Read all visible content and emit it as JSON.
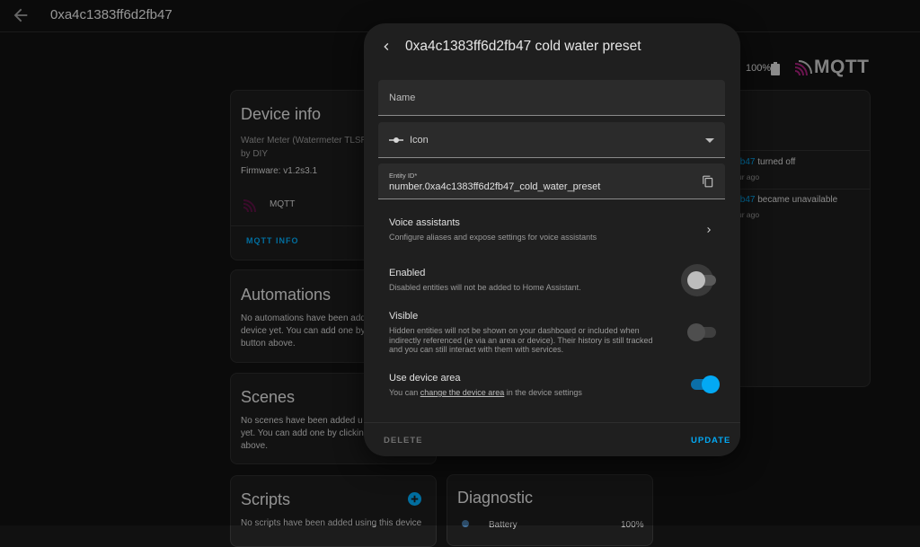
{
  "header": {
    "title": "0xa4c1383ff6d2fb47"
  },
  "topright": {
    "battery_pct": "100%",
    "brand": "MQTT"
  },
  "device_info": {
    "title": "Device info",
    "model": "Water Meter (Watermeter TLSR",
    "by": "by DIY",
    "firmware": "Firmware: v1.2s3.1",
    "integration": "MQTT",
    "link": "MQTT INFO"
  },
  "automations": {
    "title": "Automations",
    "text1": "No automations have been add",
    "text2": "device yet. You can add one by",
    "text3": "button above."
  },
  "scenes": {
    "title": "Scenes",
    "text1": "No scenes have been added u",
    "text2": "yet. You can add one by clickin",
    "text3": "above."
  },
  "scripts": {
    "title": "Scripts",
    "text1": "No scripts have been added using this device"
  },
  "diagnostic": {
    "title": "Diagnostic",
    "row_label": "Battery",
    "row_value": "100%"
  },
  "logbook": {
    "e1_name": "fb47",
    "e1_action": " turned off",
    "e1_time": "ur ago",
    "e2_name": "fb47",
    "e2_action": " became unavailable",
    "e2_time": "ur ago"
  },
  "dialog": {
    "title": "0xa4c1383ff6d2fb47 cold water preset",
    "name_label": "Name",
    "icon_label": "Icon",
    "entity_id_label": "Entity ID*",
    "entity_id_prefix": "number.",
    "entity_id_value": "0xa4c1383ff6d2fb47_cold_water_preset",
    "voice_title": "Voice assistants",
    "voice_desc": "Configure aliases and expose settings for voice assistants",
    "enabled_title": "Enabled",
    "enabled_desc": "Disabled entities will not be added to Home Assistant.",
    "visible_title": "Visible",
    "visible_desc1": "Hidden entities will not be shown on your dashboard or included when",
    "visible_desc2": "indirectly referenced (ie via an area or device). Their history is still tracked",
    "visible_desc3": "and you can still interact with them with services.",
    "area_title": "Use device area",
    "area_desc_pre": "You can ",
    "area_desc_link": "change the device area",
    "area_desc_post": " in the device settings",
    "delete_label": "DELETE",
    "update_label": "UPDATE",
    "enabled_on": false,
    "visible_on": false,
    "area_on": true
  },
  "colors": {
    "accent": "#03a9f4",
    "brand": "#a5207a"
  }
}
